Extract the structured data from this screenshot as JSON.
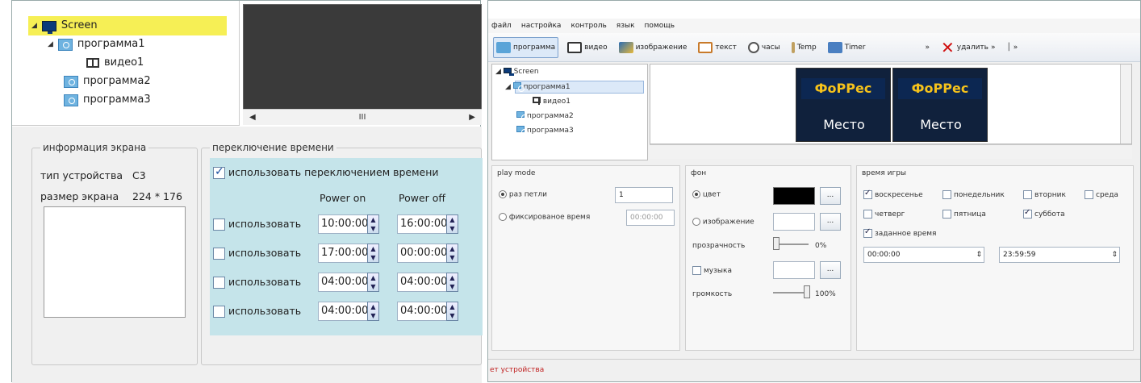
{
  "left": {
    "tree": {
      "screen": "Screen",
      "prog1": "программа1",
      "video1": "видео1",
      "prog2": "программа2",
      "prog3": "программа3"
    },
    "scroll_mark": "III",
    "screen_info": {
      "title": "информация экрана",
      "device_type_label": "тип устройства",
      "device_type_value": "C3",
      "screen_size_label": "размер экрана",
      "screen_size_value": "224 * 176"
    },
    "time_switch": {
      "title": "переключение времени",
      "use_switch_label": "использовать переключением времени",
      "power_on": "Power on",
      "power_off": "Power off",
      "use_label": "использовать",
      "rows": [
        {
          "on": "10:00:00",
          "off": "16:00:00"
        },
        {
          "on": "17:00:00",
          "off": "00:00:00"
        },
        {
          "on": "04:00:00",
          "off": "04:00:00"
        },
        {
          "on": "04:00:00",
          "off": "04:00:00"
        }
      ]
    }
  },
  "right": {
    "menu": [
      "файл",
      "настройка",
      "контроль",
      "язык",
      "помощь"
    ],
    "toolbar": {
      "program": "программа",
      "video": "видео",
      "image": "изображение",
      "text": "текст",
      "clock": "часы",
      "temp": "Temp",
      "timer": "Timer",
      "delete": "удалить"
    },
    "tree": {
      "screen": "Screen",
      "prog1": "программа1",
      "video1": "видео1",
      "prog2": "программа2",
      "prog3": "программа3"
    },
    "banner": {
      "logo": "ФоРРес",
      "text": "Место"
    },
    "play_mode": {
      "title": "play mode",
      "loops_label": "раз петли",
      "loops_value": "1",
      "fixed_label": "фиксированое время",
      "fixed_value": "00:00:00"
    },
    "background": {
      "title": "фон",
      "color_label": "цвет",
      "image_label": "изображение",
      "transparency_label": "прозрачность",
      "transparency_value": "0%",
      "music_label": "музыка",
      "volume_label": "громкость",
      "volume_value": "100%",
      "browse": "...",
      "color_hex": "#000000"
    },
    "play_time": {
      "title": "время игры",
      "days": [
        "воскресенье",
        "понедельник",
        "вторник",
        "среда",
        "четверг",
        "пятница",
        "суббота"
      ],
      "set_time_label": "заданное время",
      "start": "00:00:00",
      "end": "23:59:59"
    },
    "status": "ет устройства"
  }
}
